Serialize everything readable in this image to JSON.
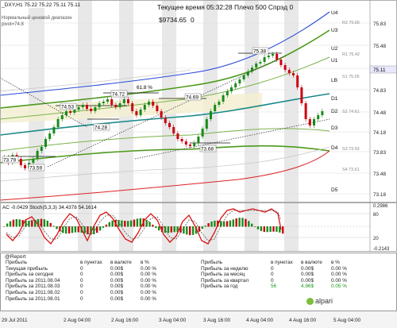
{
  "header": {
    "symbol_line": "_DXY,H1  75.22 75.22 75.11 75.11",
    "server_time": "Текущее время 05:32:28 Плечо 500 Спрэд 0",
    "balance": "$9734.65",
    "balance_suffix": "  0",
    "range_label": "Нормальный ценовой диапазон",
    "pivot_label": "pivot=74.8"
  },
  "main_chart": {
    "price_axis": [
      "75.83",
      "75.48",
      "75.14",
      "74.83",
      "74.48",
      "74.18",
      "73.83",
      "73.48",
      "73.18"
    ],
    "current_price": "75.11",
    "level_tags": [
      "R2 75.66",
      "R1 75.42",
      "S1 75.05",
      "S2 74.61",
      "S3 73.93",
      "S4 73.61"
    ],
    "level_names": [
      "U4",
      "U3",
      "U2",
      "U1",
      "LB",
      "D1",
      "D2",
      "D3",
      "D4",
      "D5"
    ],
    "annotations": [
      "75.38",
      "74.53",
      "74.72",
      "61.8 %",
      "74.69",
      "74.28",
      "73.68",
      "73.79",
      "73.59"
    ],
    "ohlc_reading": "the candlestick series is drawn as an image; individual bars are not data"
  },
  "oscillator": {
    "label": "AC -0.0429  Stoch(5,3,3) 34.4378 54.1614",
    "axis": [
      "0.2986",
      "80",
      "20",
      "-0.2143"
    ]
  },
  "report": {
    "title": "@Report",
    "columns": [
      "в пунктах",
      "в валюте",
      "в %"
    ],
    "left_rows": [
      {
        "label": "Прибыль",
        "p": "",
        "c": "",
        "pct": ""
      },
      {
        "label": "Текущая прибыль",
        "p": "0",
        "c": "0.00$",
        "pct": "0.00 %"
      },
      {
        "label": "Прибыль за сегодня",
        "p": "0",
        "c": "0.00$",
        "pct": "0.00 %"
      },
      {
        "label": "Прибыль за 2011.08.04",
        "p": "0",
        "c": "0.00$",
        "pct": "0.00 %"
      },
      {
        "label": "Прибыль за 2011.08.03",
        "p": "0",
        "c": "0.00$",
        "pct": "0.00 %"
      },
      {
        "label": "Прибыль за 2011.08.02",
        "p": "0",
        "c": "0.00$",
        "pct": "0.00 %"
      },
      {
        "label": "Прибыль за 2011.08.01",
        "p": "0",
        "c": "0.00$",
        "pct": "0.00 %"
      }
    ],
    "right_rows": [
      {
        "label": "Прибыль",
        "p": "",
        "c": "",
        "pct": ""
      },
      {
        "label": "Прибыль за неделю",
        "p": "0",
        "c": "0.00$",
        "pct": "0.00 %"
      },
      {
        "label": "Прибыль за месяц",
        "p": "0",
        "c": "0.00$",
        "pct": "0.00 %"
      },
      {
        "label": "Прибыль за квартал",
        "p": "0",
        "c": "0.00$",
        "pct": "0.00 %"
      },
      {
        "label": "Прибыль за год",
        "p": "56",
        "c": "4.96$",
        "pct": "0.05 %"
      }
    ],
    "brand": "alpari"
  },
  "time_axis": [
    "29 Jul 2011",
    "2 Aug 04:00",
    "2 Aug 16:00",
    "3 Aug 04:00",
    "3 Aug 16:00",
    "4 Aug 04:00",
    "4 Aug 16:00",
    "5 Aug 04:00"
  ],
  "colors": {
    "up": "#1a8a1a",
    "down": "#d11",
    "band_blue": "#2b4bd8",
    "band_green": "#4c9a1a",
    "band_teal": "#1a8a8a",
    "lower": "#d22"
  }
}
